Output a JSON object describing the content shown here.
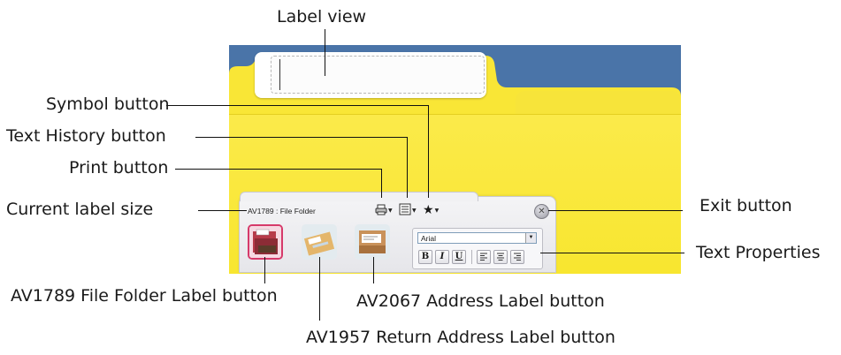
{
  "callouts": {
    "label_view": "Label view",
    "symbol_button": "Symbol button",
    "text_history_button": "Text History button",
    "print_button": "Print button",
    "current_label_size": "Current label size",
    "exit_button": "Exit button",
    "text_properties": "Text Properties",
    "av1789": "AV1789 File Folder Label button",
    "av2067": "AV2067 Address Label button",
    "av1957": "AV1957 Return Address Label button"
  },
  "toolbar": {
    "current_size": "AV1789 : File Folder",
    "font_name": "Arial",
    "icons": [
      "print-icon",
      "text-history-icon",
      "star-icon",
      "close-icon"
    ],
    "format_buttons": [
      "B",
      "I",
      "U"
    ]
  },
  "colors": {
    "folder_yellow": "#f8e62f",
    "background_blue": "#4a74a8"
  }
}
